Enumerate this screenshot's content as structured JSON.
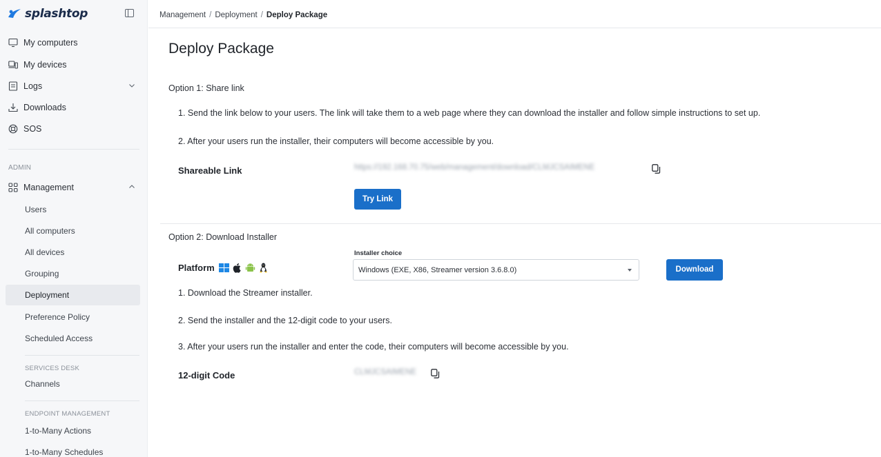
{
  "brand": {
    "name": "splashtop",
    "color": "#1f7ae0"
  },
  "sidebar": {
    "items": [
      {
        "label": "My computers",
        "icon": "monitor-icon"
      },
      {
        "label": "My devices",
        "icon": "devices-icon"
      },
      {
        "label": "Logs",
        "icon": "logs-icon",
        "expandable": true
      },
      {
        "label": "Downloads",
        "icon": "download-icon"
      },
      {
        "label": "SOS",
        "icon": "sos-icon"
      }
    ],
    "admin_label": "ADMIN",
    "management": {
      "label": "Management",
      "icon": "grid-icon",
      "expanded": true,
      "children": [
        {
          "label": "Users"
        },
        {
          "label": "All computers"
        },
        {
          "label": "All devices"
        },
        {
          "label": "Grouping"
        },
        {
          "label": "Deployment",
          "active": true
        },
        {
          "label": "Preference Policy"
        },
        {
          "label": "Scheduled Access"
        }
      ],
      "services_desk_label": "SERVICES DESK",
      "services_desk_items": [
        {
          "label": "Channels"
        }
      ],
      "endpoint_label": "ENDPOINT MANAGEMENT",
      "endpoint_items": [
        {
          "label": "1-to-Many Actions"
        },
        {
          "label": "1-to-Many Schedules"
        }
      ]
    }
  },
  "breadcrumb": {
    "items": [
      "Management",
      "Deployment"
    ],
    "separator": "/",
    "current": "Deploy Package"
  },
  "page": {
    "title": "Deploy Package",
    "option1": {
      "title": "Option 1: Share link",
      "step1": "1. Send the link below to your users. The link will take them to a web page where they can download the installer and follow simple instructions to set up.",
      "step2": "2. After your users run the installer, their computers will become accessible by you.",
      "shareable_label": "Shareable Link",
      "shareable_value": "https://192.168.70.75/web/management/download/CLMJCSAIMENE",
      "try_button": "Try Link"
    },
    "option2": {
      "title": "Option 2: Download Installer",
      "platform_label": "Platform",
      "platforms": [
        "windows-icon",
        "apple-icon",
        "android-icon",
        "linux-icon"
      ],
      "installer_choice_label": "Installer choice",
      "installer_choice_value": "Windows (EXE, X86, Streamer version 3.6.8.0)",
      "download_button": "Download",
      "step1": "1. Download the Streamer installer.",
      "step2": "2. Send the installer and the 12-digit code to your users.",
      "step3": "3. After your users run the installer and enter the code, their computers will become accessible by you.",
      "code_label": "12-digit Code",
      "code_value": "CLMJCSAIMENE"
    }
  },
  "colors": {
    "primary_button": "#1a6fc9",
    "sidebar_bg": "#f6f7f9",
    "active_item_bg": "#e8eaee"
  }
}
